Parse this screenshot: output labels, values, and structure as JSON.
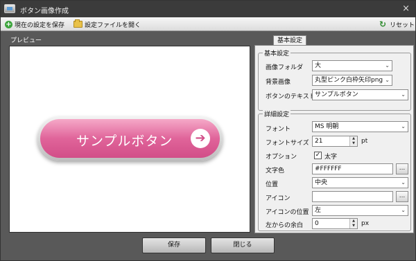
{
  "window": {
    "title": "ボタン画像作成",
    "close_glyph": "×"
  },
  "toolbar": {
    "save_settings_label": "現在の設定を保存",
    "open_settings_label": "設定ファイルを開く",
    "reset_label": "リセット"
  },
  "preview": {
    "label": "プレビュー",
    "sample_text": "サンプルボタン",
    "arrow_glyph": "➔"
  },
  "tabs": [
    {
      "label": "基本設定"
    }
  ],
  "basic": {
    "group_title": "基本設定",
    "image_folder": {
      "label": "画像フォルダ",
      "value": "大"
    },
    "background": {
      "label": "背景画像",
      "value": "丸型ピンク白枠矢印png"
    },
    "button_text": {
      "label": "ボタンのテキスト",
      "value": "サンプルボタン"
    }
  },
  "detail": {
    "group_title": "詳細設定",
    "font": {
      "label": "フォント",
      "value": "MS 明朝"
    },
    "font_size": {
      "label": "フォントサイズ",
      "value": "21",
      "unit": "pt"
    },
    "options": {
      "label": "オプション",
      "bold_label": "太字",
      "bold_checked": true
    },
    "text_color": {
      "label": "文字色",
      "value": "#FFFFFF",
      "browse": "..."
    },
    "position": {
      "label": "位置",
      "value": "中央"
    },
    "icon": {
      "label": "アイコン",
      "value": "",
      "browse": "..."
    },
    "icon_position": {
      "label": "アイコンの位置",
      "value": "左"
    },
    "left_margin": {
      "label": "左からの余白",
      "value": "0",
      "unit": "px"
    }
  },
  "buttons": {
    "save": "保存",
    "close": "閉じる"
  },
  "colors": {
    "accent_pink": "#e0649a",
    "background": "#595959",
    "panel": "#f0f0f0"
  }
}
